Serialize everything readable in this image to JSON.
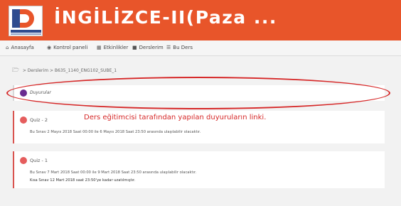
{
  "header": {
    "course_title": "İNGİLİZCE-II(Paza ..."
  },
  "navbar": {
    "items": [
      {
        "label": "Anasayfa",
        "icon": "home-icon"
      },
      {
        "label": "Kontrol paneli",
        "icon": "dashboard-icon"
      },
      {
        "label": "Etkinlikler",
        "icon": "calendar-icon"
      },
      {
        "label": "Derslerim",
        "icon": "courses-icon"
      },
      {
        "label": "Bu Ders",
        "icon": "sitemap-icon"
      }
    ]
  },
  "breadcrumb": {
    "sep": ">",
    "root": "Derslerim",
    "course": "B635_1140_ENG102_SUBE_1"
  },
  "forum": {
    "label": "Duyurular"
  },
  "annotation": "Ders eğitimcisi tarafından yapılan duyuruların linki.",
  "quizzes": [
    {
      "title": "Quiz - 2",
      "lines": [
        "Bu Sınav 2 Mayıs 2018 Saat 00:00 ile 6 Mayıs 2018 Saat 23:50 arasında ulaşılabilir olacaktır."
      ]
    },
    {
      "title": "Quiz - 1",
      "lines": [
        "Bu Sınav 7 Mart 2018 Saat 00:00 ile 9 Mart 2018 Saat 23:50 arasında ulaşılabilir olacaktır.",
        "Kısa Sınav 12 Mart 2018 saat 23:50'ye kadar uzatılmıştır."
      ]
    }
  ],
  "colors": {
    "header": "#e8552a",
    "annotation": "#d62828",
    "forum_icon": "#6a2b90",
    "quiz_icon": "#e55d5d"
  }
}
